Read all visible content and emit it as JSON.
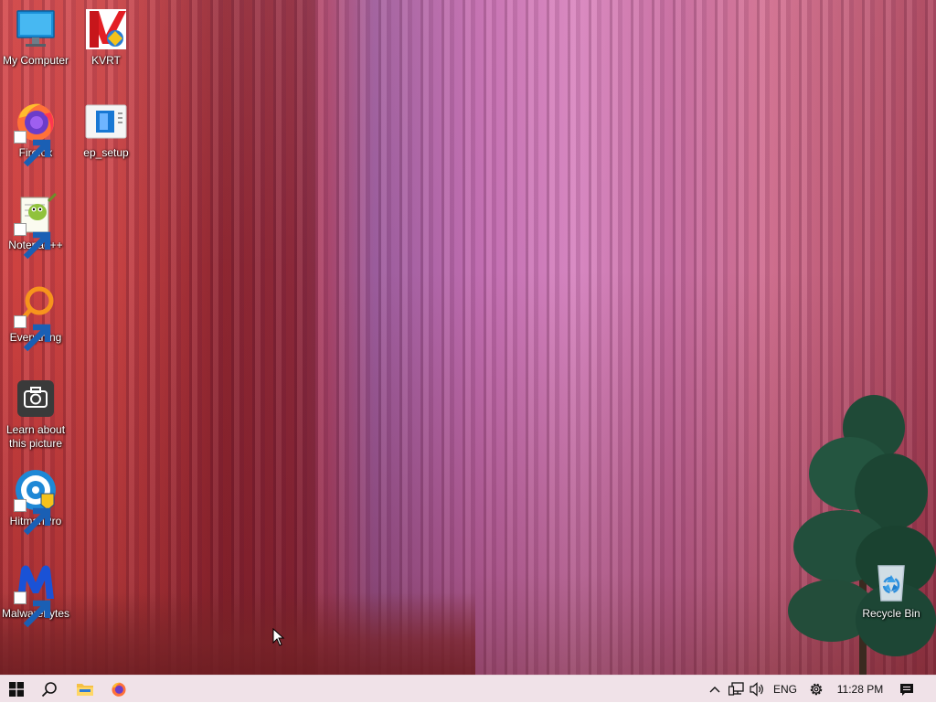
{
  "desktop": {
    "icons": [
      {
        "label": "My Computer",
        "icon": "monitor-icon"
      },
      {
        "label": "KVRT",
        "icon": "kaspersky-icon"
      },
      {
        "label": "Firefox",
        "icon": "firefox-icon"
      },
      {
        "label": "ep_setup",
        "icon": "installer-icon"
      },
      {
        "label": "Notepad++",
        "icon": "notepadpp-icon"
      },
      {
        "label": "Everything",
        "icon": "magnifier-icon"
      },
      {
        "label": "Learn about this picture",
        "icon": "camera-icon"
      },
      {
        "label": "HitmanPro",
        "icon": "hitmanpro-icon"
      },
      {
        "label": "Malwarebytes",
        "icon": "malwarebytes-icon"
      },
      {
        "label": "Recycle Bin",
        "icon": "recycle-bin-icon"
      }
    ]
  },
  "taskbar": {
    "pinned": [
      "windows-start-icon",
      "search-icon",
      "file-explorer-icon",
      "firefox-icon"
    ],
    "tray": {
      "language": "ENG",
      "time": "11:28 PM"
    }
  },
  "colors": {
    "taskbar_bg": "#f0e2e8",
    "label_text": "#ffffff"
  }
}
